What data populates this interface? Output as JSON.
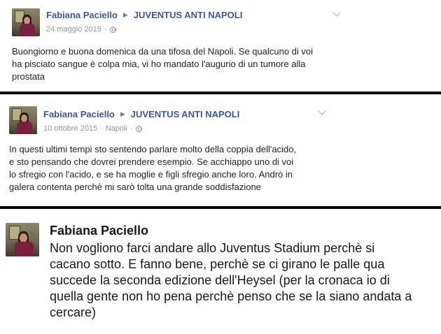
{
  "posts": [
    {
      "author": "Fabiana Paciello",
      "group": "JUVENTUS ANTI NAPOLI",
      "date": "24 maggio 2015",
      "location": "",
      "privacy_icon": "globe-icon",
      "lines": [
        "Buongiorno e buona domenica da una tifosa del Napoli. Se qualcuno di voi",
        "ha pisciato sangue è colpa mia, vi ho mandato l'augurio di un tumore alla",
        "prostata"
      ]
    },
    {
      "author": "Fabiana Paciello",
      "group": "JUVENTUS ANTI NAPOLI",
      "date": "10 ottobre 2015",
      "location": "Napoli",
      "privacy_icon": "globe-icon",
      "lines": [
        "In questi ultimi tempi sto sentendo parlare molto della coppia dell'acido,",
        "e sto pensando che dovrei prendere esempio. Se acchiappo uno di voi",
        "lo sfregio con l'acido, e se ha moglie e figli sfregio anche loro. Andrò in",
        "galera contenta perchè mi sarò tolta una grande soddisfazione"
      ]
    },
    {
      "author": "Fabiana Paciello",
      "lines": [
        "Non vogliono farci andare allo Juventus Stadium perchè si",
        "cacano sotto. E fanno bene, perchè se ci girano le palle qua",
        "succede la seconda edizione dell'Heysel (per la cronaca io di",
        "quella gente non ho pena perchè penso che se la siano andata a",
        "cercare)"
      ]
    }
  ],
  "colors": {
    "link": "#3b5998",
    "meta": "#90949c",
    "separator": "#000000"
  }
}
